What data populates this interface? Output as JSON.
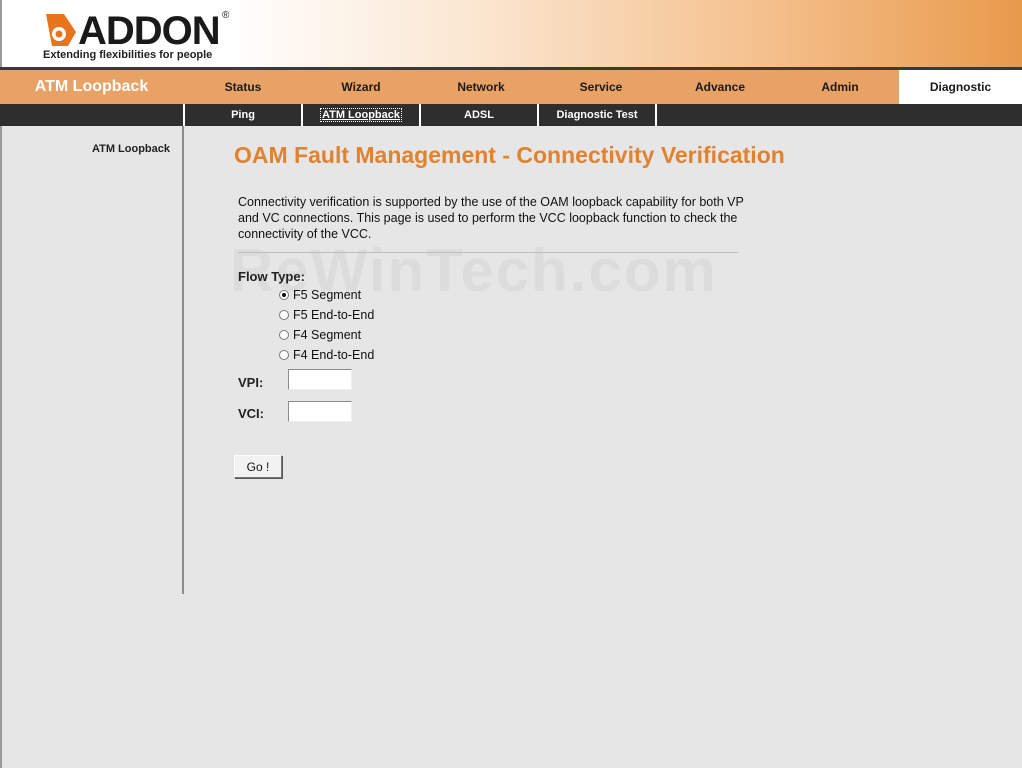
{
  "brand": {
    "name": "ADDON",
    "registered": "®",
    "tagline": "Extending flexibilities for people"
  },
  "section_title": "ATM Loopback",
  "main_nav": [
    "Status",
    "Wizard",
    "Network",
    "Service",
    "Advance",
    "Admin",
    "Diagnostic"
  ],
  "active_main_nav": "Diagnostic",
  "sub_nav": [
    "Ping",
    "ATM Loopback",
    "ADSL",
    "Diagnostic Test"
  ],
  "active_sub_nav": "ATM Loopback",
  "sidebar": {
    "items": [
      "ATM Loopback"
    ]
  },
  "page": {
    "title": "OAM Fault Management - Connectivity Verification",
    "description": "Connectivity verification is supported by the use of the OAM loopback capability for both VP and VC connections. This page is used to perform the VCC loopback function to check the connectivity of the VCC.",
    "watermark": "ReWinTech.com"
  },
  "form": {
    "flow_type_label": "Flow Type:",
    "flow_options": [
      "F5 Segment",
      "F5 End-to-End",
      "F4 Segment",
      "F4 End-to-End"
    ],
    "selected_flow": "F5 Segment",
    "vpi_label": "VPI:",
    "vpi_value": "",
    "vci_label": "VCI:",
    "vci_value": "",
    "go_label": "Go !"
  },
  "colors": {
    "accent": "#e0822e",
    "nav_bg": "#e9a266",
    "subnav_bg": "#2e2e2e",
    "page_bg": "#e6e6e6"
  }
}
